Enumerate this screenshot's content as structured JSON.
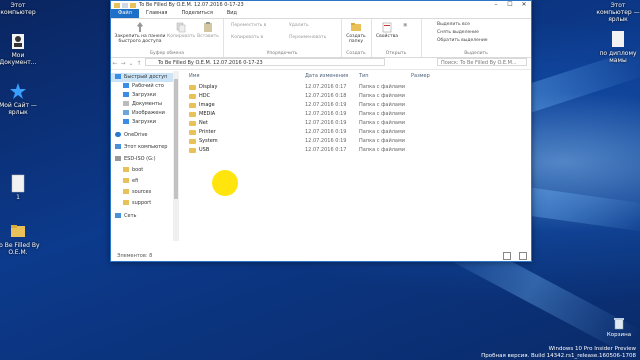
{
  "desktop": {
    "icons_left": [
      {
        "label": "Этот компьютер",
        "icon": "computer-icon"
      },
      {
        "label": "Мои Документ...",
        "icon": "user-icon"
      },
      {
        "label": "Мой Сайт — ярлык",
        "icon": "star-icon"
      },
      {
        "label": "1",
        "icon": "document-icon"
      },
      {
        "label": "To Be Filled By O.E.M.",
        "icon": "folder-icon"
      }
    ],
    "icons_right": [
      {
        "label": "Этот компьютер — ярлык",
        "icon": "computer-icon"
      },
      {
        "label": "по диплому мамы",
        "icon": "document-icon"
      },
      {
        "label": "Корзина",
        "icon": "recycle-bin-icon"
      }
    ],
    "watermark": [
      "Windows 10 Pro Insider Preview",
      "Пробная версия. Build 14342.rs1_release.160506-1708"
    ]
  },
  "window": {
    "title": "To Be Filled By O.E.M. 12.07.2016 0-17-23",
    "tabs": [
      "Файл",
      "Главная",
      "Поделиться",
      "Вид"
    ],
    "active_tab": "Файл",
    "ribbon": {
      "clipboard": {
        "pin": "Закрепить на панели быстрого доступа",
        "copy": "Копировать",
        "paste": "Вставить",
        "group": "Буфер обмена"
      },
      "organize": {
        "move": "Переместить в",
        "copy_to": "Копировать в",
        "delete": "Удалить",
        "rename": "Переименовать",
        "group": "Упорядочить"
      },
      "create": {
        "new_folder": "Создать папку",
        "group": "Создать"
      },
      "open": {
        "properties": "Свойства",
        "group": "Открыть"
      },
      "select": {
        "select_all": "Выделить все",
        "select_none": "Снять выделение",
        "invert": "Обратить выделение",
        "group": "Выделить"
      }
    },
    "address": "To Be Filled By O.E.M. 12.07.2016 0-17-23",
    "search_placeholder": "Поиск: To Be Filled By O.E.M...",
    "nav": [
      {
        "label": "Быстрый доступ",
        "icon": "star-icon",
        "selected": true,
        "indent": 0
      },
      {
        "label": "Рабочий сто",
        "icon": "desktop-icon",
        "indent": 1
      },
      {
        "label": "Загрузки",
        "icon": "download-icon",
        "indent": 1
      },
      {
        "label": "Документы",
        "icon": "document-icon",
        "indent": 1
      },
      {
        "label": "Изображени",
        "icon": "image-icon",
        "indent": 1
      },
      {
        "label": "Загрузки",
        "icon": "download-icon",
        "indent": 1
      },
      {
        "label": "OneDrive",
        "icon": "cloud-icon",
        "indent": 0
      },
      {
        "label": "Этот компьютер",
        "icon": "computer-icon",
        "indent": 0
      },
      {
        "label": "ESD-ISO (G:)",
        "icon": "drive-icon",
        "indent": 0
      },
      {
        "label": "boot",
        "icon": "folder-icon",
        "indent": 1
      },
      {
        "label": "efi",
        "icon": "folder-icon",
        "indent": 1
      },
      {
        "label": "sources",
        "icon": "folder-icon",
        "indent": 1
      },
      {
        "label": "support",
        "icon": "folder-icon",
        "indent": 1
      },
      {
        "label": "Сеть",
        "icon": "network-icon",
        "indent": 0
      }
    ],
    "columns": [
      "Имя",
      "Дата изменения",
      "Тип",
      "Размер"
    ],
    "files": [
      {
        "name": "Display",
        "date": "12.07.2016 0:17",
        "type": "Папка с файлами"
      },
      {
        "name": "HDC",
        "date": "12.07.2016 0:18",
        "type": "Папка с файлами"
      },
      {
        "name": "Image",
        "date": "12.07.2016 0:19",
        "type": "Папка с файлами"
      },
      {
        "name": "MEDIA",
        "date": "12.07.2016 0:19",
        "type": "Папка с файлами"
      },
      {
        "name": "Net",
        "date": "12.07.2016 0:19",
        "type": "Папка с файлами"
      },
      {
        "name": "Printer",
        "date": "12.07.2016 0:19",
        "type": "Папка с файлами"
      },
      {
        "name": "System",
        "date": "12.07.2016 0:19",
        "type": "Папка с файлами"
      },
      {
        "name": "USB",
        "date": "12.07.2016 0:17",
        "type": "Папка с файлами"
      }
    ],
    "status": "Элементов: 8"
  },
  "colors": {
    "accent": "#1e6fc7",
    "folder": "#e8c15a",
    "cursor_highlight": "#ffe400"
  }
}
